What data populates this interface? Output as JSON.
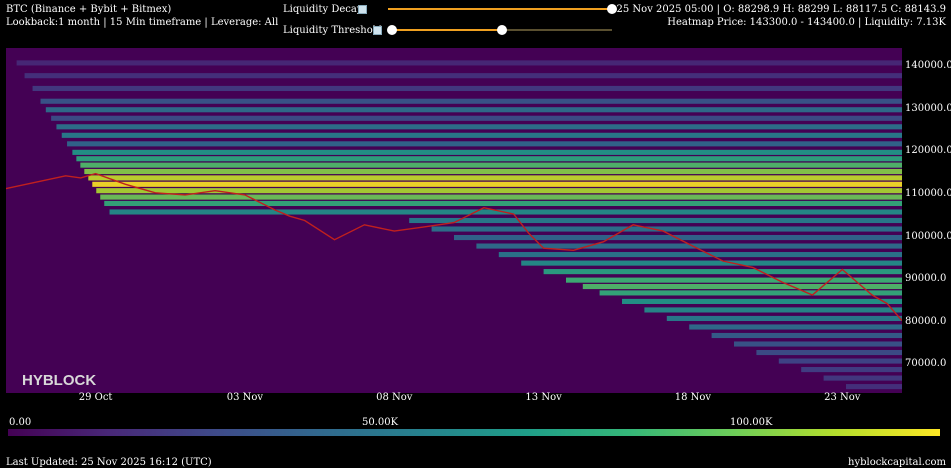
{
  "header": {
    "title": "BTC (Binance + Bybit + Bitmex)",
    "subtitle": "Lookback:1 month | 15 Min timeframe | Leverage: All",
    "ohlc": "25 Nov 2025 05:00 | O: 88298.9 H: 88299 L: 88117.5 C: 88143.9",
    "heatmap_info": "Heatmap Price: 143300.0 - 143400.0 | Liquidity: 7.13K"
  },
  "controls": {
    "decay_label": "Liquidity Decay",
    "threshold_label": "Liquidity Threshold",
    "decay_value": 1.0,
    "threshold_range": [
      0.0,
      0.5
    ]
  },
  "colors": {
    "slider": "#f0a020",
    "price_line": "#c0201e"
  },
  "colormap": "viridis",
  "watermark": "HYBLOCK",
  "footer": {
    "updated": "Last Updated: 25 Nov 2025 16:12 (UTC)",
    "site": "hyblockcapital.com"
  },
  "chart_data": {
    "type": "heatmap",
    "y_ticks": [
      "140000.0",
      "130000.0",
      "120000.0",
      "110000.0",
      "100000.0",
      "90000.0",
      "80000.0",
      "70000.0"
    ],
    "y_tick_values": [
      140000,
      130000,
      120000,
      110000,
      100000,
      90000,
      80000,
      70000
    ],
    "ylim": [
      63500,
      144500
    ],
    "x_ticks": [
      "29 Oct",
      "03 Nov",
      "08 Nov",
      "13 Nov",
      "18 Nov",
      "23 Nov"
    ],
    "x_tick_days": [
      3,
      8,
      13,
      18,
      23,
      28
    ],
    "xlim_days": [
      0,
      30
    ],
    "colorbar": {
      "ticks": [
        "0.00",
        "50.00K",
        "100.00K"
      ],
      "tick_values": [
        0,
        50000,
        100000
      ],
      "max": 128000
    },
    "price_series": {
      "x_days": [
        0,
        1,
        2,
        2.5,
        3,
        4,
        5,
        6,
        7,
        8,
        9,
        9.5,
        10,
        11,
        12,
        13,
        14,
        15,
        16,
        17,
        17.5,
        18,
        19,
        20,
        21,
        22,
        23,
        24,
        25,
        26,
        27,
        28,
        29,
        29.5,
        30
      ],
      "y": [
        111500,
        113000,
        114500,
        114000,
        115000,
        112500,
        110500,
        110000,
        111000,
        110000,
        106500,
        105000,
        104000,
        99500,
        103000,
        101500,
        102500,
        103500,
        107000,
        105500,
        101000,
        97500,
        97000,
        99000,
        103000,
        101500,
        98000,
        94500,
        93000,
        89500,
        86500,
        92500,
        86500,
        84500,
        80500
      ]
    },
    "bands": [
      {
        "price": 141000,
        "intensity": 0.12
      },
      {
        "price": 138000,
        "intensity": 0.15
      },
      {
        "price": 135000,
        "intensity": 0.18
      },
      {
        "price": 132000,
        "intensity": 0.28
      },
      {
        "price": 130000,
        "intensity": 0.38
      },
      {
        "price": 128000,
        "intensity": 0.25
      },
      {
        "price": 126000,
        "intensity": 0.4
      },
      {
        "price": 124000,
        "intensity": 0.45
      },
      {
        "price": 122000,
        "intensity": 0.35
      },
      {
        "price": 120000,
        "intensity": 0.55
      },
      {
        "price": 118500,
        "intensity": 0.62
      },
      {
        "price": 117000,
        "intensity": 0.72
      },
      {
        "price": 115500,
        "intensity": 0.82
      },
      {
        "price": 114000,
        "intensity": 0.92
      },
      {
        "price": 112500,
        "intensity": 1.0
      },
      {
        "price": 111000,
        "intensity": 0.88
      },
      {
        "price": 109500,
        "intensity": 0.78
      },
      {
        "price": 108000,
        "intensity": 0.65
      },
      {
        "price": 106000,
        "intensity": 0.52
      },
      {
        "price": 104000,
        "intensity": 0.45
      },
      {
        "price": 102000,
        "intensity": 0.4
      },
      {
        "price": 100000,
        "intensity": 0.35
      },
      {
        "price": 98000,
        "intensity": 0.38
      },
      {
        "price": 96000,
        "intensity": 0.42
      },
      {
        "price": 94000,
        "intensity": 0.52
      },
      {
        "price": 92000,
        "intensity": 0.6
      },
      {
        "price": 90000,
        "intensity": 0.68
      },
      {
        "price": 88500,
        "intensity": 0.72
      },
      {
        "price": 87000,
        "intensity": 0.65
      },
      {
        "price": 85000,
        "intensity": 0.55
      },
      {
        "price": 83000,
        "intensity": 0.5
      },
      {
        "price": 81000,
        "intensity": 0.45
      },
      {
        "price": 79000,
        "intensity": 0.38
      },
      {
        "price": 77000,
        "intensity": 0.32
      },
      {
        "price": 75000,
        "intensity": 0.28
      },
      {
        "price": 73000,
        "intensity": 0.25
      },
      {
        "price": 71000,
        "intensity": 0.22
      },
      {
        "price": 69000,
        "intensity": 0.2
      },
      {
        "price": 67000,
        "intensity": 0.18
      },
      {
        "price": 65000,
        "intensity": 0.15
      }
    ]
  }
}
